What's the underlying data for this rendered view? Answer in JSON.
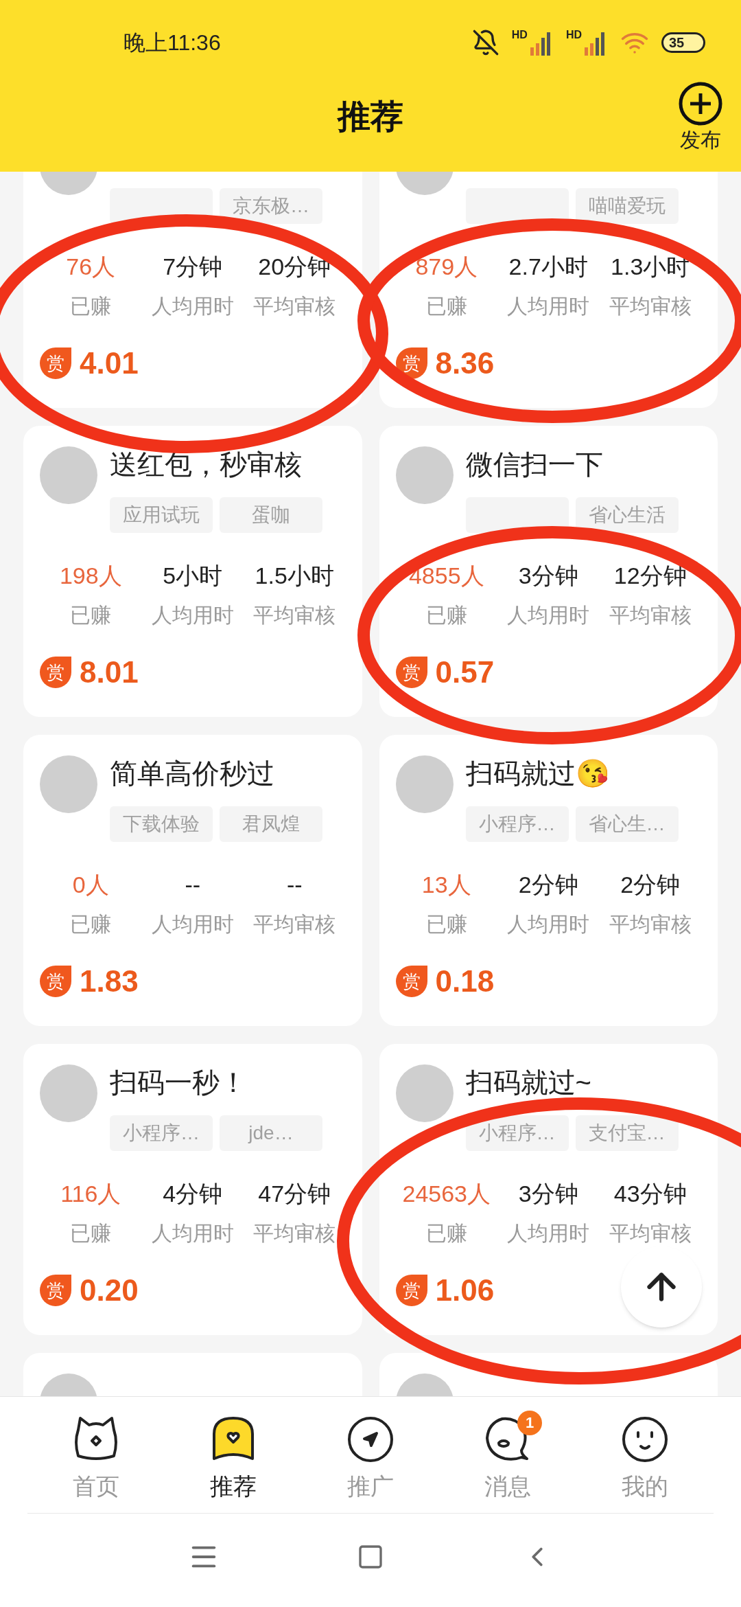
{
  "status_bar": {
    "time": "晚上11:36",
    "signals": [
      "HD",
      "HD"
    ],
    "battery": "35"
  },
  "header": {
    "title": "推荐",
    "publish": "发布"
  },
  "cards": [
    {
      "kind": "task",
      "tags": [
        {
          "kind": "blank"
        },
        {
          "kind": "text",
          "text": "京东极…"
        }
      ],
      "stats": [
        {
          "kind": "earned",
          "value": "76人",
          "label": "已赚"
        },
        {
          "kind": "duration",
          "value": "7分钟",
          "label": "人均用时"
        },
        {
          "kind": "duration",
          "value": "20分钟",
          "label": "平均审核"
        }
      ],
      "reward_badge": "赏",
      "reward": "4.01"
    },
    {
      "kind": "task",
      "tags": [
        {
          "kind": "blank"
        },
        {
          "kind": "text",
          "text": "喵喵爱玩"
        }
      ],
      "stats": [
        {
          "kind": "earned",
          "value": "879人",
          "label": "已赚"
        },
        {
          "kind": "duration",
          "value": "2.7小时",
          "label": "人均用时"
        },
        {
          "kind": "duration",
          "value": "1.3小时",
          "label": "平均审核"
        }
      ],
      "reward_badge": "赏",
      "reward": "8.36"
    },
    {
      "kind": "task",
      "title": "送红包，秒审核",
      "tags": [
        {
          "kind": "text",
          "text": "应用试玩"
        },
        {
          "kind": "text",
          "text": "蛋咖"
        }
      ],
      "stats": [
        {
          "kind": "earned",
          "value": "198人",
          "label": "已赚"
        },
        {
          "kind": "duration",
          "value": "5小时",
          "label": "人均用时"
        },
        {
          "kind": "duration",
          "value": "1.5小时",
          "label": "平均审核"
        }
      ],
      "reward_badge": "赏",
      "reward": "8.01"
    },
    {
      "kind": "task",
      "title": "微信扫一下",
      "tags": [
        {
          "kind": "blank"
        },
        {
          "kind": "text",
          "text": "省心生活"
        }
      ],
      "stats": [
        {
          "kind": "earned",
          "value": "4855人",
          "label": "已赚"
        },
        {
          "kind": "duration",
          "value": "3分钟",
          "label": "人均用时"
        },
        {
          "kind": "duration",
          "value": "12分钟",
          "label": "平均审核"
        }
      ],
      "reward_badge": "赏",
      "reward": "0.57"
    },
    {
      "kind": "task",
      "title": "简单高价秒过",
      "tags": [
        {
          "kind": "text",
          "text": "下载体验"
        },
        {
          "kind": "text",
          "text": "君凤煌"
        }
      ],
      "stats": [
        {
          "kind": "earned",
          "value": "0人",
          "label": "已赚"
        },
        {
          "kind": "duration",
          "value": "--",
          "label": "人均用时"
        },
        {
          "kind": "duration",
          "value": "--",
          "label": "平均审核"
        }
      ],
      "reward_badge": "赏",
      "reward": "1.83"
    },
    {
      "kind": "task",
      "title": "扫码就过😘",
      "tags": [
        {
          "kind": "text",
          "text": "小程序…"
        },
        {
          "kind": "text",
          "text": "省心生…"
        }
      ],
      "stats": [
        {
          "kind": "earned",
          "value": "13人",
          "label": "已赚"
        },
        {
          "kind": "duration",
          "value": "2分钟",
          "label": "人均用时"
        },
        {
          "kind": "duration",
          "value": "2分钟",
          "label": "平均审核"
        }
      ],
      "reward_badge": "赏",
      "reward": "0.18"
    },
    {
      "kind": "task",
      "title": "扫码一秒！",
      "tags": [
        {
          "kind": "text",
          "text": "小程序…"
        },
        {
          "kind": "text",
          "text": "jde…"
        }
      ],
      "stats": [
        {
          "kind": "earned",
          "value": "116人",
          "label": "已赚"
        },
        {
          "kind": "duration",
          "value": "4分钟",
          "label": "人均用时"
        },
        {
          "kind": "duration",
          "value": "47分钟",
          "label": "平均审核"
        }
      ],
      "reward_badge": "赏",
      "reward": "0.20"
    },
    {
      "kind": "task",
      "title": "扫码就过~",
      "tags": [
        {
          "kind": "text",
          "text": "小程序…"
        },
        {
          "kind": "text",
          "text": "支付宝…"
        }
      ],
      "stats": [
        {
          "kind": "earned",
          "value": "24563人",
          "label": "已赚"
        },
        {
          "kind": "duration",
          "value": "3分钟",
          "label": "人均用时"
        },
        {
          "kind": "duration",
          "value": "43分钟",
          "label": "平均审核"
        }
      ],
      "reward_badge": "赏",
      "reward": "1.06"
    },
    {
      "kind": "peek"
    },
    {
      "kind": "peek"
    }
  ],
  "bottom_nav": [
    {
      "label": "首页",
      "selected": false
    },
    {
      "label": "推荐",
      "selected": true
    },
    {
      "label": "推广",
      "selected": false
    },
    {
      "label": "消息",
      "selected": false,
      "badge": "1"
    },
    {
      "label": "我的",
      "selected": false
    }
  ]
}
